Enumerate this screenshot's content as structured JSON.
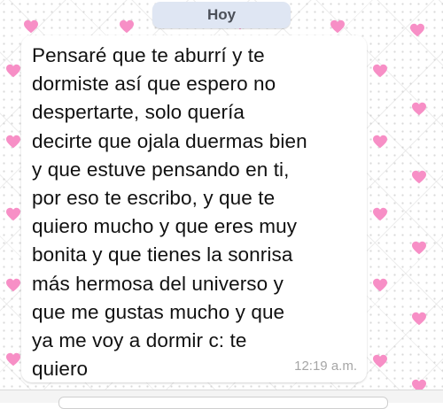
{
  "date_separator": {
    "label": "Hoy"
  },
  "message": {
    "text": "Pensaré que te aburrí y te\ndormiste así que espero no\ndespertarte, solo quería\ndecirte que ojala duermas bien\ny que estuve pensando en ti,\npor eso te escribo, y que te\nquiero mucho y que eres muy\nbonita y que tienes la sonrisa\nmás hermosa del universo y\nque me gustas mucho y que\nya me voy a dormir c: te\nquiero",
    "time": "12:19 a.m."
  },
  "colors": {
    "heart": "#f78fc6",
    "bubble": "#ffffff",
    "date_pill": "#dfe6f3",
    "time_text": "#a6a6a6"
  },
  "icons": {
    "wallpaper_decoration": "heart-icon"
  }
}
